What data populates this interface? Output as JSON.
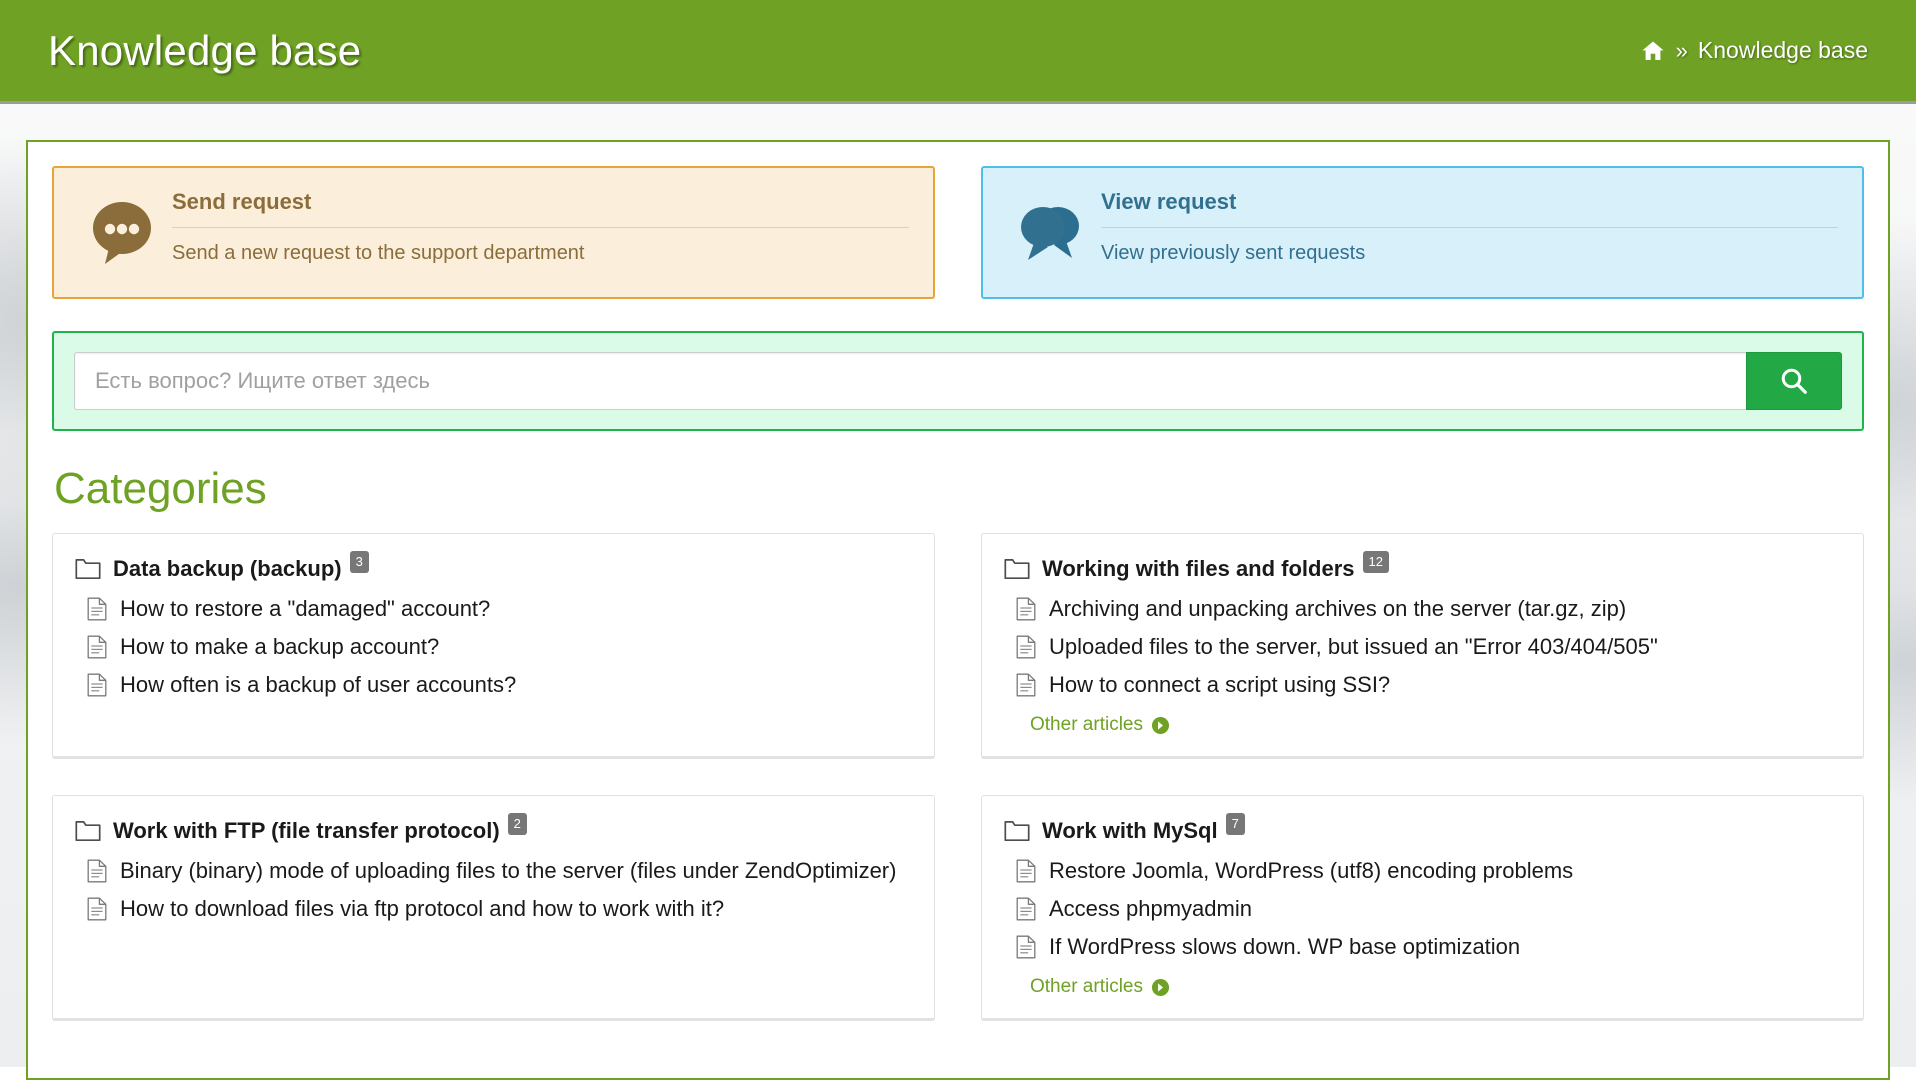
{
  "header": {
    "title": "Knowledge base",
    "breadcrumb": {
      "home_icon": "home-icon",
      "separator": "»",
      "current": "Knowledge base"
    },
    "background_color": "#6fa224"
  },
  "requests": {
    "send": {
      "icon": "speech-bubble-dots-icon",
      "title": "Send request",
      "subtitle": "Send a new request to the support department",
      "border_color": "#e8a33d",
      "background_color": "#fbeeda",
      "text_color": "#8a6d3b"
    },
    "view": {
      "icon": "double-speech-bubble-icon",
      "title": "View request",
      "subtitle": "View previously sent requests",
      "border_color": "#52bde8",
      "background_color": "#d8f0fa",
      "text_color": "#31708f"
    }
  },
  "search": {
    "placeholder": "Есть вопрос? Ищите ответ здесь",
    "value": "",
    "button_icon": "search-icon",
    "button_color": "#22a844",
    "panel_background": "#d9fbe7",
    "panel_border": "#21b24b"
  },
  "categories_section": {
    "heading": "Categories",
    "heading_color": "#6fa224",
    "more_label": "Other articles",
    "more_icon": "arrow-circle-right-icon",
    "folder_icon": "folder-icon",
    "article_icon": "document-icon",
    "cards": [
      {
        "title": "Data backup (backup)",
        "count": "3",
        "articles": [
          "How to restore a \"damaged\" account?",
          "How to make a backup account?",
          "How often is a backup of user accounts?"
        ],
        "has_more": false
      },
      {
        "title": "Working with files and folders",
        "count": "12",
        "articles": [
          "Archiving and unpacking archives on the server (tar.gz, zip)",
          "Uploaded files to the server, but issued an \"Error 403/404/505\"",
          "How to connect a script using SSI?"
        ],
        "has_more": true
      },
      {
        "title": "Work with FTP (file transfer protocol)",
        "count": "2",
        "articles": [
          "Binary (binary) mode of uploading files to the server (files under ZendOptimizer)",
          "How to download files via ftp protocol and how to work with it?"
        ],
        "has_more": false
      },
      {
        "title": "Work with MySql",
        "count": "7",
        "articles": [
          "Restore Joomla, WordPress (utf8) encoding problems",
          "Access phpmyadmin",
          "If WordPress slows down. WP base optimization"
        ],
        "has_more": true
      }
    ]
  }
}
